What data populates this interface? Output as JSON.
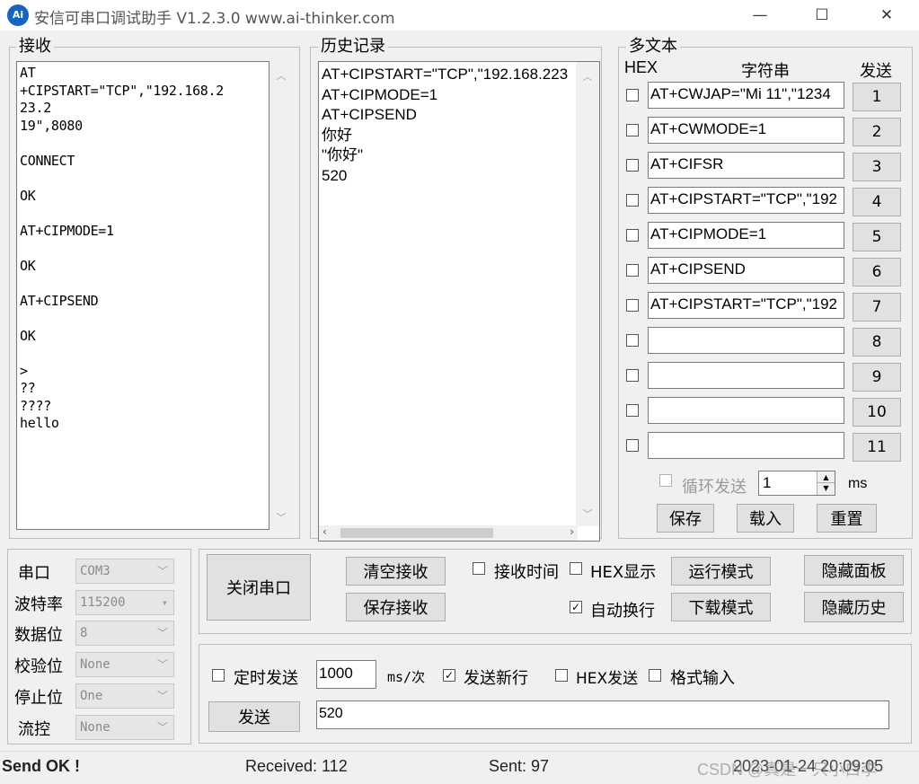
{
  "window": {
    "app_icon_text": "Ai",
    "title": "安信可串口调试助手 V1.2.3.0     www.ai-thinker.com",
    "minimize": "—",
    "maximize": "☐",
    "close": "✕"
  },
  "receive": {
    "label": "接收",
    "lines": "AT\n+CIPSTART=\"TCP\",\"192.168.2\n23.2\n19\",8080\n\nCONNECT\n\nOK\n\nAT+CIPMODE=1\n\nOK\n\nAT+CIPSEND\n\nOK\n\n>\n??\n????\nhello"
  },
  "history": {
    "label": "历史记录",
    "lines": "AT+CIPSTART=\"TCP\",\"192.168.223\nAT+CIPMODE=1\nAT+CIPSEND\n你好\n\"你好\"\n520"
  },
  "multi": {
    "label": "多文本",
    "col_hex": "HEX",
    "col_string": "字符串",
    "col_send": "发送",
    "rows": [
      {
        "value": "AT+CWJAP=\"Mi 11\",\"1234",
        "num": "1"
      },
      {
        "value": "AT+CWMODE=1",
        "num": "2"
      },
      {
        "value": "AT+CIFSR",
        "num": "3"
      },
      {
        "value": "AT+CIPSTART=\"TCP\",\"192",
        "num": "4"
      },
      {
        "value": "AT+CIPMODE=1",
        "num": "5"
      },
      {
        "value": "AT+CIPSEND",
        "num": "6"
      },
      {
        "value": "AT+CIPSTART=\"TCP\",\"192",
        "num": "7"
      },
      {
        "value": "",
        "num": "8"
      },
      {
        "value": "",
        "num": "9"
      },
      {
        "value": "",
        "num": "10"
      },
      {
        "value": "",
        "num": "11"
      }
    ],
    "loop_send_label": "循环发送",
    "loop_value": "1",
    "loop_unit": "ms",
    "save": "保存",
    "load": "载入",
    "reset": "重置"
  },
  "port": {
    "rows": [
      {
        "label": "串口",
        "value": "COM3"
      },
      {
        "label": "波特率",
        "value": "115200"
      },
      {
        "label": "数据位",
        "value": "8"
      },
      {
        "label": "校验位",
        "value": "None"
      },
      {
        "label": "停止位",
        "value": "One"
      },
      {
        "label": "流控",
        "value": "None"
      }
    ]
  },
  "controls": {
    "close_port": "关闭串口",
    "clear_receive": "清空接收",
    "save_receive": "保存接收",
    "recv_time": "接收时间",
    "hex_display": "HEX显示",
    "auto_newline": "自动换行",
    "run_mode": "运行模式",
    "download_mode": "下载模式",
    "hide_panel": "隐藏面板",
    "hide_history": "隐藏历史"
  },
  "send_area": {
    "timed_send": "定时发送",
    "interval": "1000",
    "interval_unit": "ms/次",
    "send_newline": "发送新行",
    "hex_send": "HEX发送",
    "format_input": "格式输入",
    "send_button": "发送",
    "send_text": "520"
  },
  "status": {
    "send_ok": "Send OK !",
    "received": "Received: 112",
    "sent": "Sent: 97",
    "datetime": "2023-01-24 20:09:05",
    "watermark": "CSDN @真是一只小白李"
  }
}
